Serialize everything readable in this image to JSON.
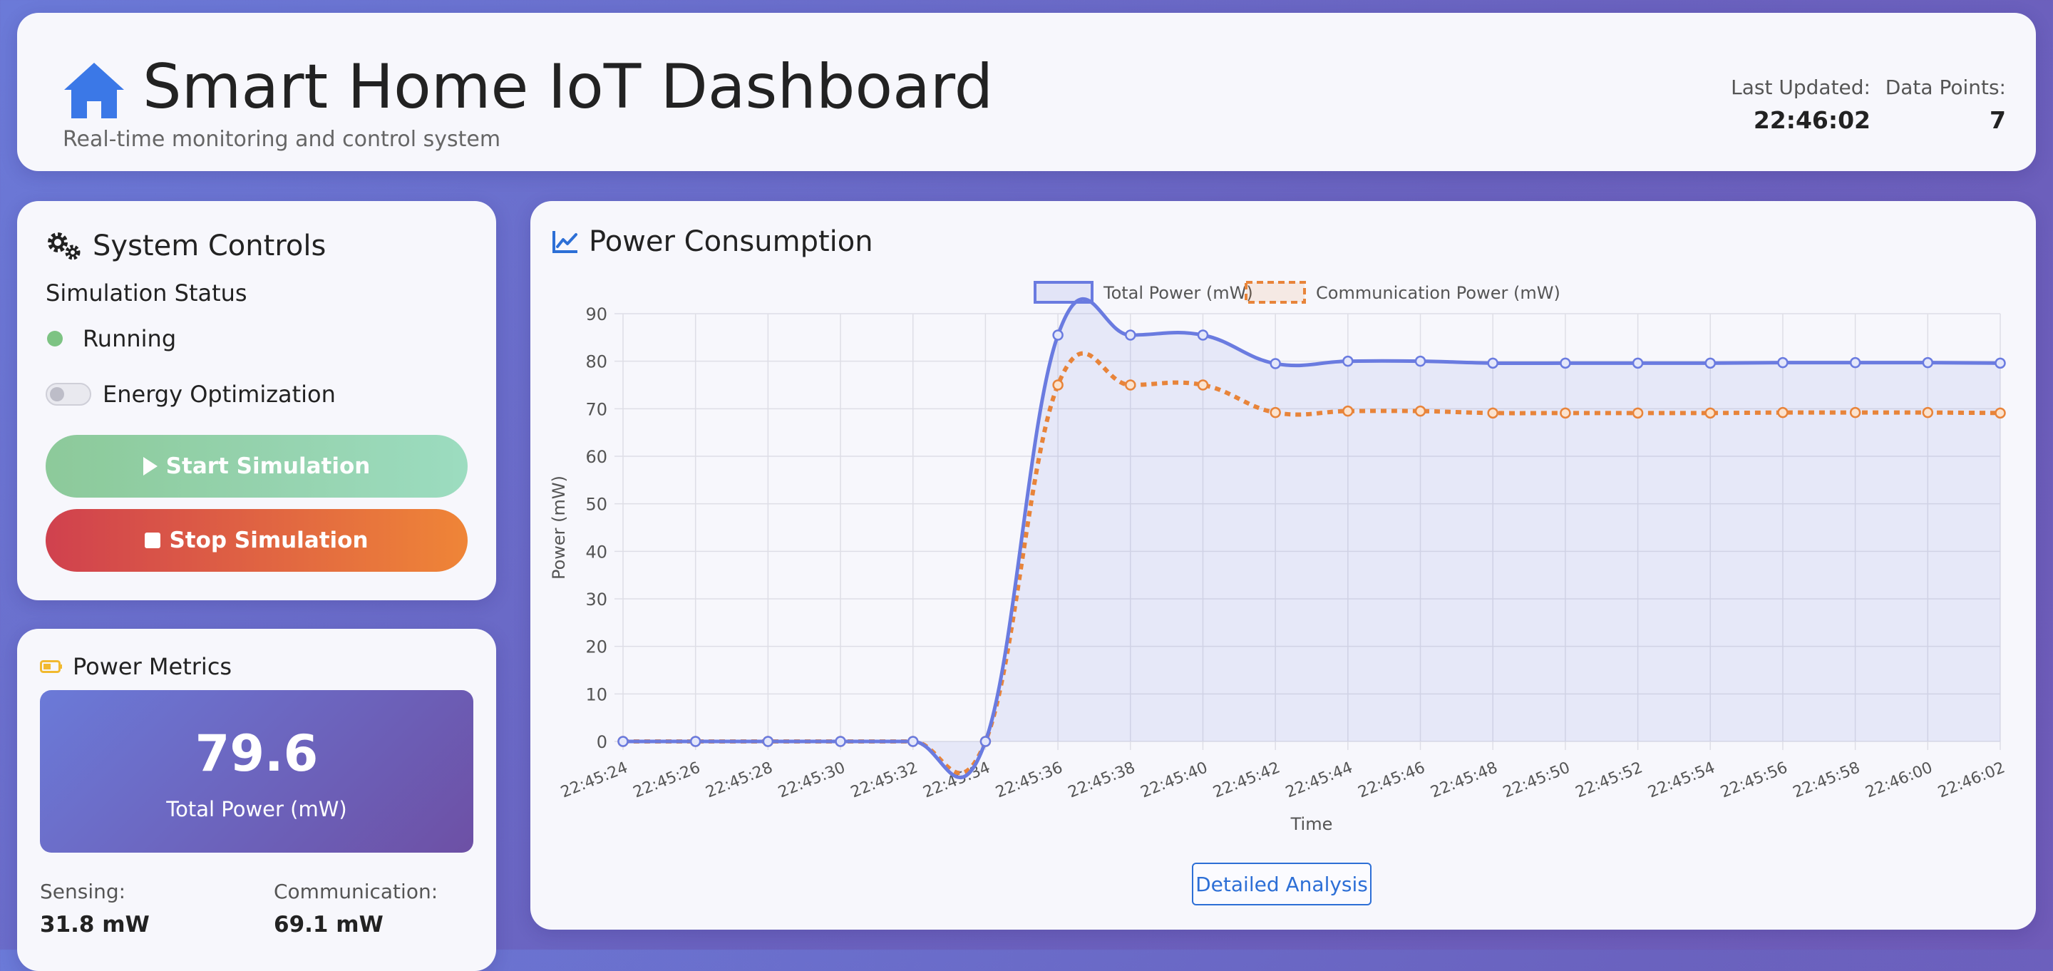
{
  "header": {
    "title": "Smart Home IoT Dashboard",
    "subtitle": "Real-time monitoring and control system",
    "last_updated_label": "Last Updated:",
    "last_updated_value": "22:46:02",
    "data_points_label": "Data Points:",
    "data_points_value": "7",
    "icon": "home-icon"
  },
  "controls": {
    "title": "System Controls",
    "status_label": "Simulation Status",
    "status_value": "Running",
    "optimization_label": "Energy Optimization",
    "optimization_enabled": false,
    "start_label": "Start Simulation",
    "stop_label": "Stop Simulation"
  },
  "metrics": {
    "title": "Power Metrics",
    "total_value": "79.6",
    "total_label": "Total Power (mW)",
    "sensing_label": "Sensing:",
    "sensing_value": "31.8 mW",
    "comm_label": "Communication:",
    "comm_value": "69.1 mW"
  },
  "chart_panel": {
    "title": "Power Consumption",
    "analysis_button": "Detailed Analysis"
  },
  "colors": {
    "total_series": "#6a7be0",
    "comm_series": "#e8843a",
    "status_running": "#7dc383",
    "accent_blue": "#2d6fd6"
  },
  "chart_data": {
    "type": "line",
    "xlabel": "Time",
    "ylabel": "Power (mW)",
    "ylim": [
      0,
      90
    ],
    "yticks": [
      0,
      10,
      20,
      30,
      40,
      50,
      60,
      70,
      80,
      90
    ],
    "grid": true,
    "legend_position": "top",
    "x": [
      "22:45:24",
      "22:45:26",
      "22:45:28",
      "22:45:30",
      "22:45:32",
      "22:45:34",
      "22:45:36",
      "22:45:38",
      "22:45:40",
      "22:45:42",
      "22:45:44",
      "22:45:46",
      "22:45:48",
      "22:45:50",
      "22:45:52",
      "22:45:54",
      "22:45:56",
      "22:45:58",
      "22:46:00",
      "22:46:02"
    ],
    "series": [
      {
        "name": "Total Power (mW)",
        "style": "solid-filled",
        "values": [
          0,
          0,
          0,
          0,
          0,
          0,
          85.5,
          85.5,
          85.5,
          79.5,
          80,
          80,
          79.6,
          79.6,
          79.6,
          79.6,
          79.7,
          79.7,
          79.7,
          79.6
        ]
      },
      {
        "name": "Communication Power (mW)",
        "style": "dashed",
        "values": [
          0,
          0,
          0,
          0,
          0,
          0,
          75,
          75,
          75,
          69.2,
          69.5,
          69.5,
          69.1,
          69.1,
          69.1,
          69.1,
          69.2,
          69.2,
          69.2,
          69.1
        ]
      }
    ]
  }
}
